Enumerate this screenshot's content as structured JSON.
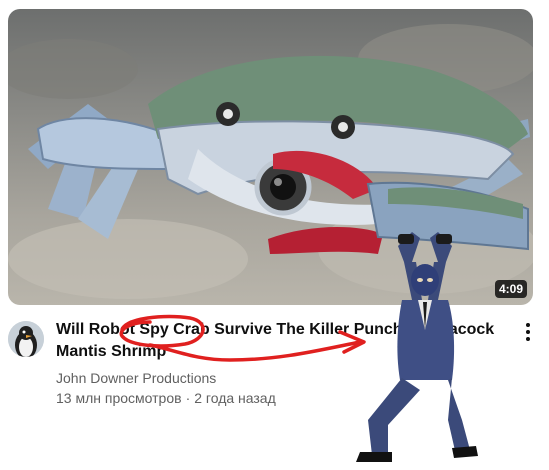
{
  "video": {
    "title": "Will Robot Spy Crab Survive The Killer Punch Of Peacock Mantis Shrimp",
    "duration": "4:09",
    "channel": "John Downer Productions",
    "views": "13 млн просмотров",
    "separator": "·",
    "age": "2 года назад"
  },
  "colors": {
    "annotation": "#e0201f",
    "duration_bg": "#000000",
    "title_text": "#0f0f0f",
    "secondary_text": "#606060"
  },
  "icons": {
    "more": "more-vert-icon",
    "avatar": "penguin-avatar"
  }
}
